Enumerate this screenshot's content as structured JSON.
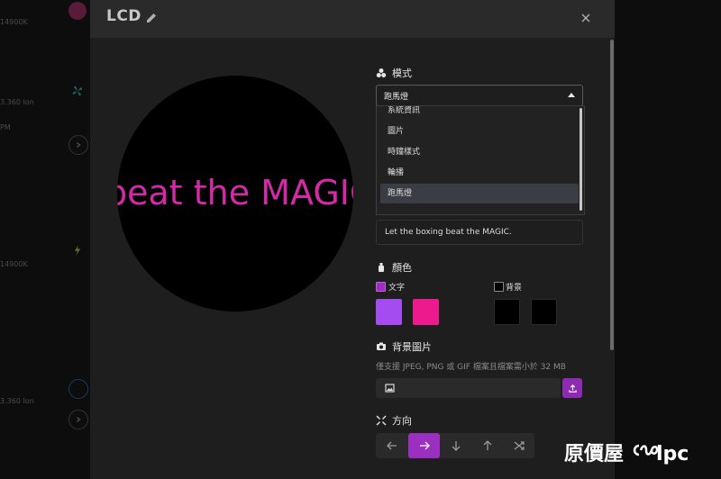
{
  "background": {
    "texts": [
      "14900K",
      "3.360 Ion",
      "PM",
      "14900K",
      "3.360 Ion"
    ]
  },
  "modal": {
    "title": "LCD",
    "preview_text": "beat the MAGIC"
  },
  "mode": {
    "label": "模式",
    "selected": "跑馬燈",
    "options": [
      "系統資訊",
      "圖片",
      "時鐘樣式",
      "輪播",
      "跑馬燈"
    ]
  },
  "description": {
    "value": "Let the boxing beat the MAGIC."
  },
  "colors": {
    "label": "顏色",
    "text_label": "文字",
    "bg_label": "背景",
    "text_swatches": [
      "#a44cf0",
      "#ec1a8d"
    ],
    "bg_swatches": [
      "#000000",
      "#000000"
    ],
    "accent": "#9a2fc0"
  },
  "bg_image": {
    "label": "背景圖片",
    "hint": "僅支援 JPEG, PNG 或 GIF 檔案且檔案需小於 32 MB"
  },
  "direction": {
    "label": "方向",
    "buttons": [
      "arrow-left",
      "arrow-right",
      "arrow-down",
      "arrow-up",
      "shuffle"
    ],
    "active": "arrow-right"
  },
  "watermark": {
    "text_cn": "原價屋",
    "text_en": "lpc"
  }
}
